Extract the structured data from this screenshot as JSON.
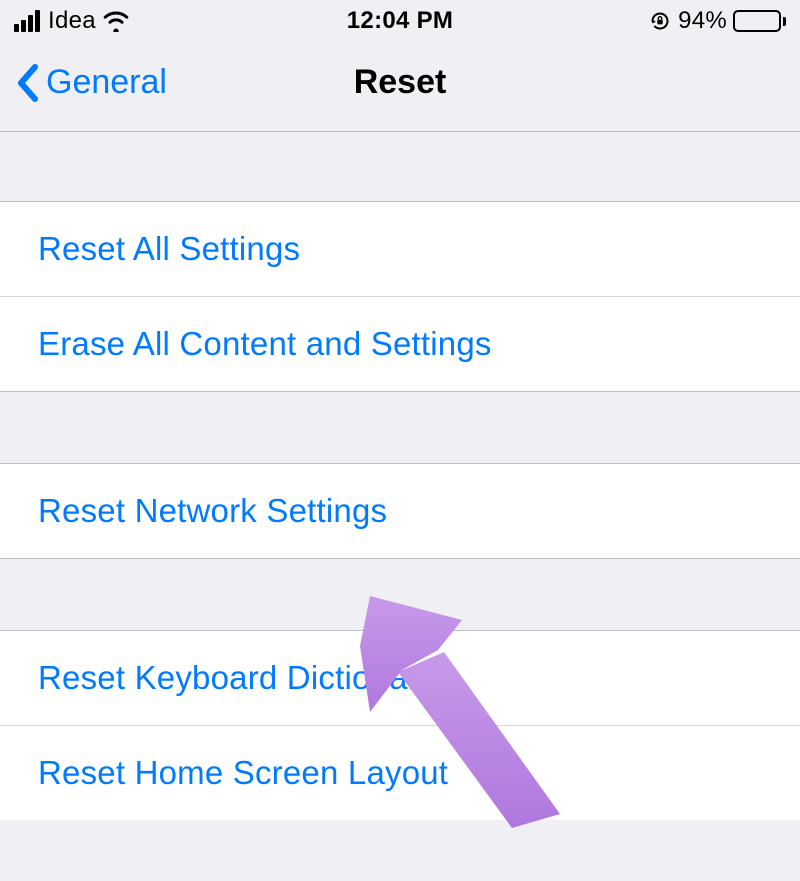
{
  "status": {
    "carrier": "Idea",
    "time": "12:04 PM",
    "battery_pct": "94%"
  },
  "nav": {
    "back_label": "General",
    "title": "Reset"
  },
  "groups": [
    {
      "items": [
        "Reset All Settings",
        "Erase All Content and Settings"
      ]
    },
    {
      "items": [
        "Reset Network Settings"
      ]
    },
    {
      "items": [
        "Reset Keyboard Dictionary",
        "Reset Home Screen Layout"
      ]
    }
  ],
  "colors": {
    "link": "#007aff",
    "background": "#efeff4",
    "arrow": "#b983e6"
  }
}
